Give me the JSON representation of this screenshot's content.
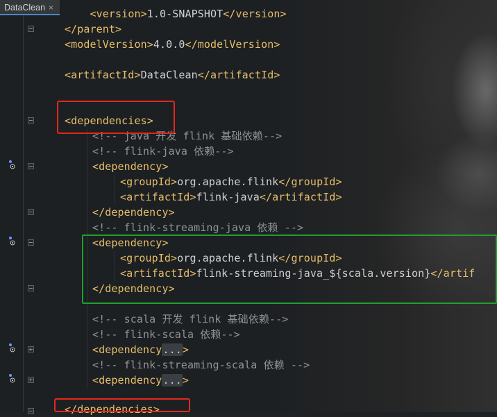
{
  "tab": {
    "title": "DataClean",
    "close": "×"
  },
  "colors": {
    "tag": "#e8bf6a",
    "text": "#d0d0d0",
    "comment": "#8e9396",
    "red_box": "#e3281b",
    "green_box": "#1fa02f"
  },
  "code": {
    "line0": {
      "open": "<version>",
      "text": "1.0-SNAPSHOT",
      "close": "</version>"
    },
    "line1": {
      "close": "</parent>"
    },
    "line2": {
      "open": "<modelVersion>",
      "text": "4.0.0",
      "close": "</modelVersion>"
    },
    "line4": {
      "open": "<artifactId>",
      "text": "DataClean",
      "close": "</artifactId>"
    },
    "line7": {
      "open": "<dependencies>"
    },
    "line8": {
      "comment": "<!-- java 开发 flink 基础依赖-->"
    },
    "line9": {
      "comment": "<!-- flink-java 依赖-->"
    },
    "line10": {
      "open": "<dependency>"
    },
    "line11": {
      "open": "<groupId>",
      "text": "org.apache.flink",
      "close": "</groupId>"
    },
    "line12": {
      "open": "<artifactId>",
      "text": "flink-java",
      "close": "</artifactId>"
    },
    "line13": {
      "close": "</dependency>"
    },
    "line14": {
      "comment": "<!-- flink-streaming-java 依赖 -->"
    },
    "line15": {
      "open": "<dependency>"
    },
    "line16": {
      "open": "<groupId>",
      "text": "org.apache.flink",
      "close": "</groupId>"
    },
    "line17": {
      "open": "<artifactId>",
      "text": "flink-streaming-java_${scala.version}",
      "close": "</artif"
    },
    "line18": {
      "close": "</dependency>"
    },
    "line20": {
      "comment": "<!-- scala 开发 flink 基础依赖-->"
    },
    "line21": {
      "comment": "<!-- flink-scala 依赖-->"
    },
    "line22": {
      "open": "<dependency",
      "fold": "...",
      "close": ">"
    },
    "line23": {
      "comment": "<!-- flink-streaming-scala 依赖 -->"
    },
    "line24": {
      "open": "<dependency",
      "fold": "...",
      "close": ">"
    },
    "line26": {
      "close": "</dependencies>"
    }
  },
  "gutter": {
    "maven_icon": "maven-dependency-icon",
    "fold_icon": "fold-marker-icon"
  }
}
